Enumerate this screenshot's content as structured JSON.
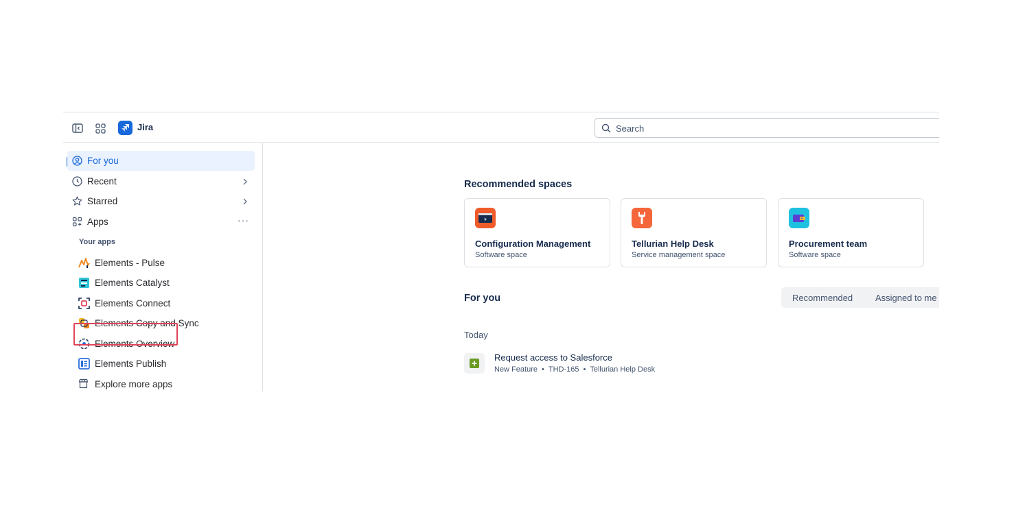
{
  "topnav": {
    "app_name": "Jira",
    "search_placeholder": "Search"
  },
  "sidebar": {
    "items": [
      {
        "label": "For you",
        "icon": "person-circle-icon",
        "active": true
      },
      {
        "label": "Recent",
        "icon": "clock-icon"
      },
      {
        "label": "Starred",
        "icon": "star-icon"
      },
      {
        "label": "Apps",
        "icon": "apps-grid-icon"
      }
    ],
    "section_label": "Your apps",
    "apps": [
      {
        "label": "Elements - Pulse",
        "icon": "pulse-icon"
      },
      {
        "label": "Elements Catalyst",
        "icon": "catalyst-icon"
      },
      {
        "label": "Elements Connect",
        "icon": "connect-icon"
      },
      {
        "label": "Elements Copy and Sync",
        "icon": "copy-sync-icon"
      },
      {
        "label": "Elements Overview",
        "icon": "overview-icon"
      },
      {
        "label": "Elements Publish",
        "icon": "publish-icon"
      },
      {
        "label": "Explore more apps",
        "icon": "store-icon"
      }
    ]
  },
  "main": {
    "recommended_title": "Recommended spaces",
    "spaces": [
      {
        "name": "Configuration Management",
        "type": "Software space",
        "icon_color": "#f15b2a"
      },
      {
        "name": "Tellurian Help Desk",
        "type": "Service management space",
        "icon_color": "#f5663b"
      },
      {
        "name": "Procurement team",
        "type": "Software space",
        "icon_color": "#1fc1e0"
      }
    ],
    "foryou_title": "For you",
    "tabs": [
      "Recommended",
      "Assigned to me"
    ],
    "today_label": "Today",
    "work_item": {
      "title": "Request access to Salesforce",
      "type": "New Feature",
      "key": "THD-165",
      "space": "Tellurian Help Desk"
    }
  },
  "colors": {
    "accent": "#1868db",
    "highlight": "#e0445a",
    "feature_green": "#6a9a23"
  }
}
